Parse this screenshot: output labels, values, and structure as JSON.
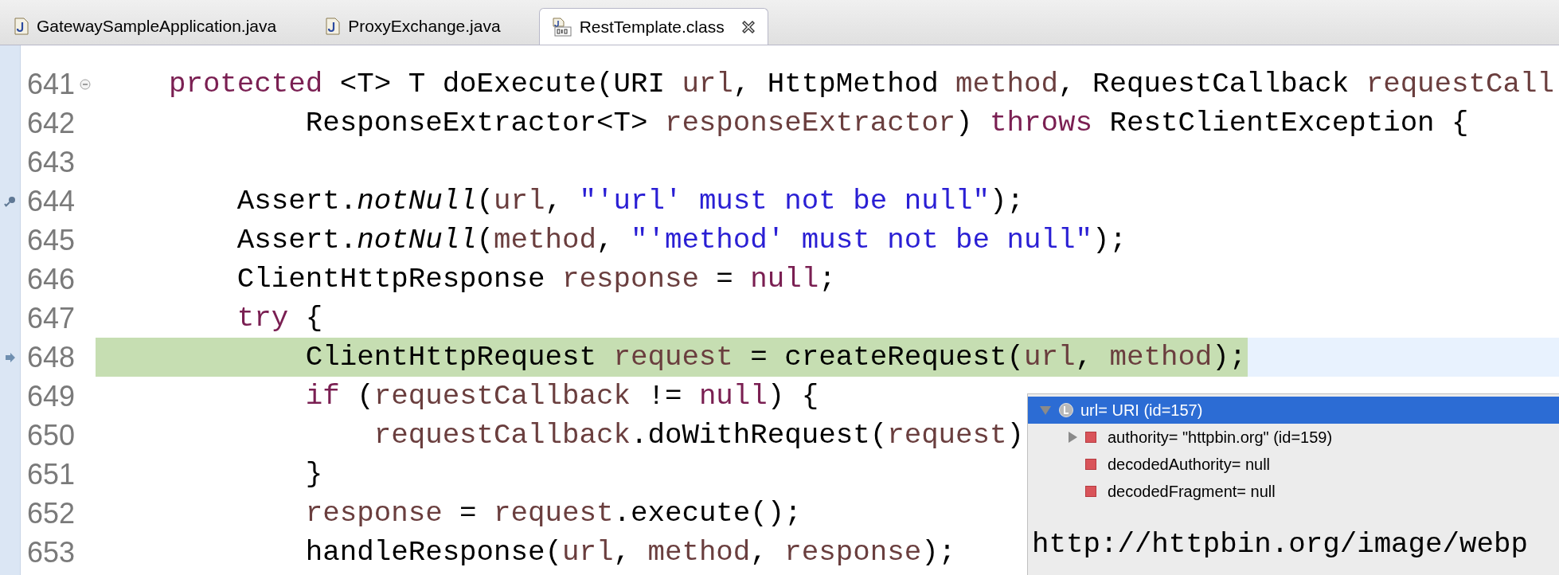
{
  "tabs": [
    {
      "label": "GatewaySampleApplication.java",
      "kind": "java",
      "selected": false
    },
    {
      "label": "ProxyExchange.java",
      "kind": "java",
      "selected": false
    },
    {
      "label": "RestTemplate.class",
      "kind": "class",
      "selected": true
    }
  ],
  "editor": {
    "lines": [
      {
        "number": "641",
        "kind": "code",
        "expanded": true,
        "tokens": [
          {
            "kind": "keyword",
            "text": "    protected"
          },
          {
            "kind": "plain",
            "text": " <T> T doExecute(URI "
          },
          {
            "kind": "var",
            "text": "url"
          },
          {
            "kind": "plain",
            "text": ", HttpMethod "
          },
          {
            "kind": "var",
            "text": "method"
          },
          {
            "kind": "plain",
            "text": ", RequestCallback "
          },
          {
            "kind": "var",
            "text": "requestCall"
          }
        ]
      },
      {
        "number": "642",
        "kind": "code",
        "tokens": [
          {
            "kind": "plain",
            "text": "            ResponseExtractor<T> "
          },
          {
            "kind": "var",
            "text": "responseExtractor"
          },
          {
            "kind": "plain",
            "text": ") "
          },
          {
            "kind": "keyword",
            "text": "throws"
          },
          {
            "kind": "plain",
            "text": " RestClientException {"
          }
        ]
      },
      {
        "number": "643",
        "kind": "code"
      },
      {
        "number": "644",
        "kind": "occurrence",
        "tokens": [
          {
            "kind": "plain",
            "text": "        Assert."
          },
          {
            "kind": "static",
            "text": "notNull"
          },
          {
            "kind": "plain",
            "text": "("
          },
          {
            "kind": "var",
            "text": "url"
          },
          {
            "kind": "plain",
            "text": ", "
          },
          {
            "kind": "string",
            "text": "\"'url' must not be null\""
          },
          {
            "kind": "plain",
            "text": ");"
          }
        ]
      },
      {
        "number": "645",
        "kind": "code",
        "tokens": [
          {
            "kind": "plain",
            "text": "        Assert."
          },
          {
            "kind": "static",
            "text": "notNull"
          },
          {
            "kind": "plain",
            "text": "("
          },
          {
            "kind": "var",
            "text": "method"
          },
          {
            "kind": "plain",
            "text": ", "
          },
          {
            "kind": "string",
            "text": "\"'method' must not be null\""
          },
          {
            "kind": "plain",
            "text": ");"
          }
        ]
      },
      {
        "number": "646",
        "kind": "code",
        "tokens": [
          {
            "kind": "plain",
            "text": "        ClientHttpResponse "
          },
          {
            "kind": "var",
            "text": "response"
          },
          {
            "kind": "plain",
            "text": " = "
          },
          {
            "kind": "keyword",
            "text": "null"
          },
          {
            "kind": "plain",
            "text": ";"
          }
        ]
      },
      {
        "number": "647",
        "kind": "code",
        "tokens": [
          {
            "kind": "keyword",
            "text": "        try"
          },
          {
            "kind": "plain",
            "text": " {"
          }
        ]
      },
      {
        "number": "648",
        "kind": "current",
        "tokens": [
          {
            "kind": "plain",
            "text": "            ClientHttpRequest "
          },
          {
            "kind": "var",
            "text": "request"
          },
          {
            "kind": "plain",
            "text": " = createRequest("
          },
          {
            "kind": "var",
            "text": "url"
          },
          {
            "kind": "plain",
            "text": ", "
          },
          {
            "kind": "var",
            "text": "method"
          },
          {
            "kind": "plain",
            "text": ");"
          }
        ]
      },
      {
        "number": "649",
        "kind": "code",
        "tokens": [
          {
            "kind": "keyword",
            "text": "            if"
          },
          {
            "kind": "plain",
            "text": " ("
          },
          {
            "kind": "var",
            "text": "requestCallback"
          },
          {
            "kind": "plain",
            "text": " != "
          },
          {
            "kind": "keyword",
            "text": "null"
          },
          {
            "kind": "plain",
            "text": ") {"
          }
        ]
      },
      {
        "number": "650",
        "kind": "code",
        "tokens": [
          {
            "kind": "var",
            "text": "                requestCallback"
          },
          {
            "kind": "plain",
            "text": ".doWithRequest("
          },
          {
            "kind": "var",
            "text": "request"
          },
          {
            "kind": "plain",
            "text": ")"
          }
        ]
      },
      {
        "number": "651",
        "kind": "code",
        "tokens": [
          {
            "kind": "plain",
            "text": "            }"
          }
        ]
      },
      {
        "number": "652",
        "kind": "code",
        "tokens": [
          {
            "kind": "var",
            "text": "            response"
          },
          {
            "kind": "plain",
            "text": " = "
          },
          {
            "kind": "var",
            "text": "request"
          },
          {
            "kind": "plain",
            "text": ".execute();"
          }
        ]
      },
      {
        "number": "653",
        "kind": "code",
        "tokens": [
          {
            "kind": "plain",
            "text": "            handleResponse("
          },
          {
            "kind": "var",
            "text": "url"
          },
          {
            "kind": "plain",
            "text": ", "
          },
          {
            "kind": "var",
            "text": "method"
          },
          {
            "kind": "plain",
            "text": ", "
          },
          {
            "kind": "var",
            "text": "response"
          },
          {
            "kind": "plain",
            "text": ");"
          }
        ]
      }
    ]
  },
  "inspector": {
    "tree": [
      {
        "label": "url= URI  (id=157)",
        "kind": "local",
        "selected": true,
        "expanded": true,
        "children": [
          {
            "label": "authority= \"httpbin.org\" (id=159)",
            "kind": "field",
            "selected": false,
            "expanded": false
          },
          {
            "label": "decodedAuthority= null",
            "kind": "field",
            "selected": false
          },
          {
            "label": "decodedFragment= null",
            "kind": "field",
            "selected": false
          }
        ]
      }
    ],
    "detail": "http://httpbin.org/image/webp"
  }
}
